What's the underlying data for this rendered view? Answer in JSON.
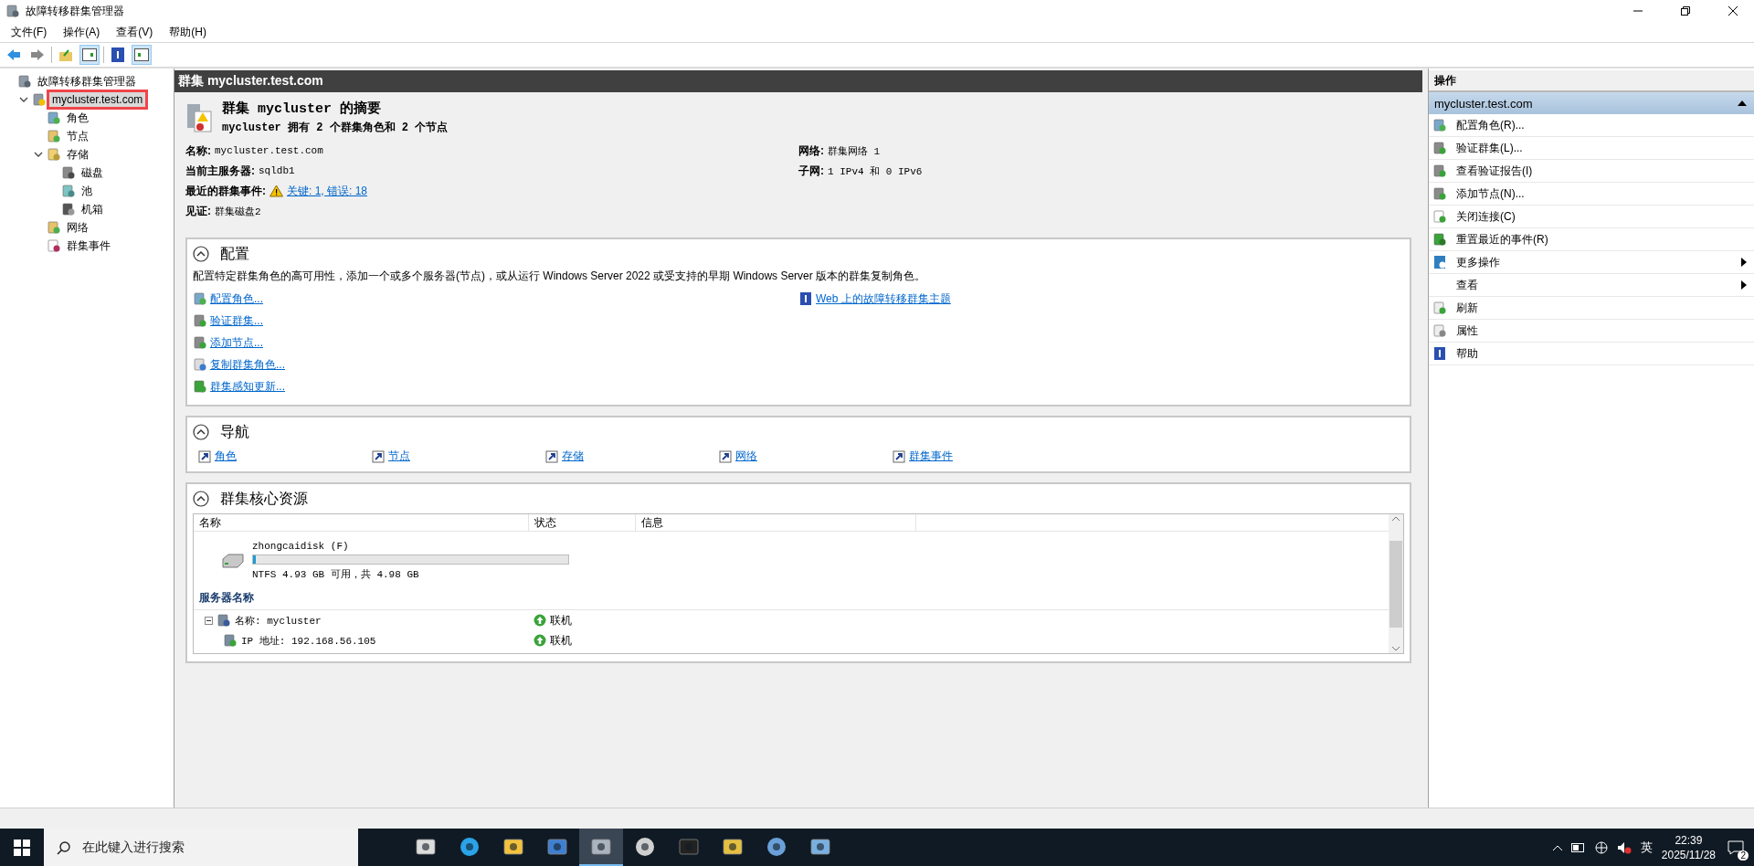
{
  "window": {
    "title": "故障转移群集管理器"
  },
  "menu": [
    "文件(F)",
    "操作(A)",
    "查看(V)",
    "帮助(H)"
  ],
  "tree": {
    "label": "故障转移群集管理器",
    "children": [
      {
        "label": "mycluster.test.com",
        "selected": true,
        "highlighted": true,
        "expanded": true,
        "children": [
          {
            "label": "角色",
            "selected": false
          },
          {
            "label": "节点",
            "selected": false
          },
          {
            "label": "存储",
            "selected": false,
            "expanded": true,
            "children": [
              {
                "label": "磁盘",
                "selected": false
              },
              {
                "label": "池",
                "selected": false
              },
              {
                "label": "机箱",
                "selected": false
              }
            ]
          },
          {
            "label": "网络",
            "selected": false
          },
          {
            "label": "群集事件",
            "selected": false
          }
        ]
      }
    ]
  },
  "content": {
    "header": "群集 mycluster.test.com",
    "summary": {
      "title": "群集 **mycluster** 的摘要",
      "subtitle": "mycluster 拥有 2 个群集角色和 2 个节点",
      "left": [
        {
          "label": "名称:",
          "value": "mycluster.test.com"
        },
        {
          "label": "当前主服务器:",
          "value": "sqldb1"
        },
        {
          "label": "最近的群集事件:",
          "link": "关键: 1, 错误: 18",
          "warning": true
        },
        {
          "label": "见证:",
          "value": "群集磁盘2"
        }
      ],
      "right": [
        {
          "label": "网络:",
          "value": "群集网络 1"
        },
        {
          "label": "子网:",
          "value": "1 IPv4 和 0 IPv6"
        }
      ]
    },
    "configure": {
      "title": "配置",
      "expanded": true,
      "description": "配置特定群集角色的高可用性，添加一个或多个服务器(节点)，或从运行 Windows Server 2022 或受支持的早期 Windows Server 版本的群集复制角色。",
      "links": [
        "配置角色...",
        "验证群集...",
        "添加节点...",
        "复制群集角色...",
        "群集感知更新..."
      ],
      "help_link": "Web 上的故障转移群集主题"
    },
    "navigate": {
      "title": "导航",
      "expanded": true,
      "links": [
        "角色",
        "节点",
        "存储",
        "网络",
        "群集事件"
      ]
    },
    "core": {
      "title": "群集核心资源",
      "expanded": true,
      "columns": [
        "名称",
        "状态",
        "信息"
      ],
      "disk": {
        "name": "zhongcaidisk (F)",
        "level": 0.01,
        "info": "NTFS 4.93 GB 可用，共 4.98 GB"
      },
      "group": "服务器名称",
      "rows": [
        {
          "name": "名称: mycluster",
          "status": "联机",
          "expanded": true,
          "children": [
            {
              "name": "IP 地址: 192.168.56.105",
              "status": "联机"
            }
          ]
        }
      ]
    }
  },
  "actions": {
    "title": "操作",
    "section": "mycluster.test.com",
    "expanded": true,
    "items": [
      {
        "label": "配置角色(R)...",
        "submenu": false
      },
      {
        "label": "验证群集(L)...",
        "submenu": false
      },
      {
        "label": "查看验证报告(I)",
        "submenu": false
      },
      {
        "label": "添加节点(N)...",
        "submenu": false
      },
      {
        "label": "关闭连接(C)",
        "submenu": false
      },
      {
        "label": "重置最近的事件(R)",
        "submenu": false
      },
      {
        "label": "更多操作",
        "submenu": true
      },
      {
        "label": "查看",
        "submenu": true
      },
      {
        "label": "刷新",
        "submenu": false
      },
      {
        "label": "属性",
        "submenu": false
      },
      {
        "label": "帮助",
        "submenu": false
      }
    ]
  },
  "taskbar": {
    "search_placeholder": "在此键入进行搜索",
    "apps": [
      {
        "active": false
      },
      {
        "active": false
      },
      {
        "active": false
      },
      {
        "active": false
      },
      {
        "active": true
      },
      {
        "active": false
      },
      {
        "active": false
      },
      {
        "active": false
      },
      {
        "active": false
      },
      {
        "active": false
      }
    ],
    "ime": "英",
    "time": "22:39",
    "date": "2025/11/28",
    "notifications": "2"
  }
}
